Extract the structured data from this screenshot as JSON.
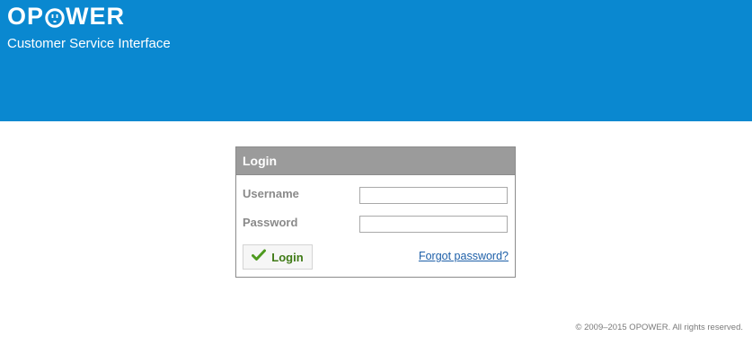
{
  "header": {
    "logo_left": "OP",
    "logo_right": "WER",
    "logo_icon": "outlet-face-icon",
    "subtitle": "Customer Service Interface",
    "bg_color": "#0a88d0"
  },
  "login": {
    "title": "Login",
    "username_label": "Username",
    "username_value": "",
    "password_label": "Password",
    "password_value": "",
    "submit_label": "Login",
    "submit_icon": "checkmark-icon",
    "forgot_link": "Forgot password?"
  },
  "footer": {
    "copyright": "© 2009–2015 OPOWER. All rights reserved."
  }
}
